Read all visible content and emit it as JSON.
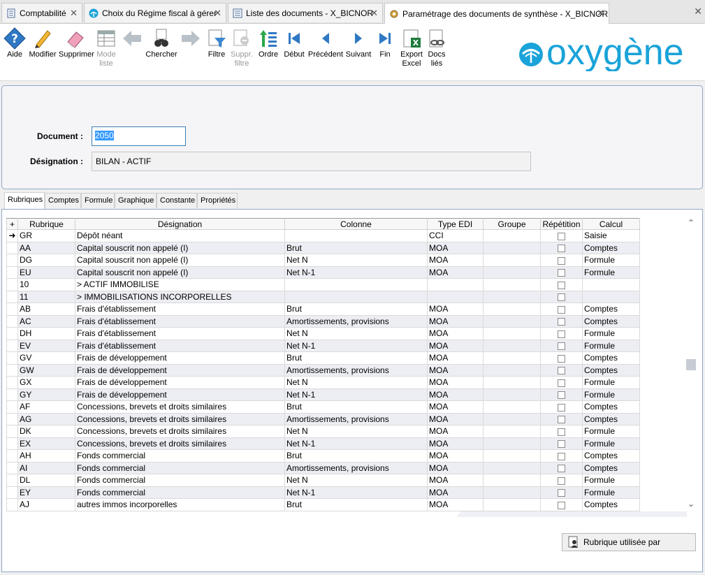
{
  "tabs": [
    {
      "label": "Comptabilité"
    },
    {
      "label": "Choix du Régime fiscal à gérer"
    },
    {
      "label": "Liste des documents - X_BICNOR"
    },
    {
      "label": "Paramétrage des documents de synthèse - X_BICNOR"
    }
  ],
  "toolbar": {
    "aide": "Aide",
    "modifier": "Modifier",
    "supprimer": "Supprimer",
    "mode_liste_1": "Mode",
    "mode_liste_2": "liste",
    "chercher": "Chercher",
    "filtre": "Filtre",
    "suppr_filtre_1": "Suppr.",
    "suppr_filtre_2": "filtre",
    "ordre": "Ordre",
    "debut": "Début",
    "precedent": "Précédent",
    "suivant": "Suivant",
    "fin": "Fin",
    "export_1": "Export",
    "export_2": "Excel",
    "docs_1": "Docs",
    "docs_2": "liés"
  },
  "brand": {
    "name": "oxygène",
    "color": "#1aa3d9"
  },
  "form": {
    "document_label": "Document :",
    "document_value": "2050",
    "designation_label": "Désignation :",
    "designation_value": "BILAN - ACTIF"
  },
  "section_tabs": [
    "Rubriques",
    "Comptes",
    "Formule",
    "Graphique",
    "Constante",
    "Propriétés"
  ],
  "grid": {
    "columns": [
      "Rubrique",
      "Désignation",
      "Colonne",
      "Type EDI",
      "Groupe",
      "Répétition",
      "Calcul"
    ],
    "rows": [
      {
        "rub": "GR",
        "des": "Dépôt néant",
        "col": "",
        "edi": "CCI",
        "grp": "",
        "calc": "Saisie"
      },
      {
        "rub": "AA",
        "des": "Capital souscrit non appelé (I)",
        "col": "Brut",
        "edi": "MOA",
        "grp": "",
        "calc": "Comptes"
      },
      {
        "rub": "DG",
        "des": "Capital souscrit non appelé (I)",
        "col": "Net N",
        "edi": "MOA",
        "grp": "",
        "calc": "Formule"
      },
      {
        "rub": "EU",
        "des": "Capital souscrit non appelé (I)",
        "col": "Net N-1",
        "edi": "MOA",
        "grp": "",
        "calc": "Formule"
      },
      {
        "rub": "10",
        "des": "> ACTIF IMMOBILISE",
        "col": "",
        "edi": "",
        "grp": "",
        "calc": ""
      },
      {
        "rub": "11",
        "des": "> IMMOBILISATIONS INCORPORELLES",
        "col": "",
        "edi": "",
        "grp": "",
        "calc": ""
      },
      {
        "rub": "AB",
        "des": "Frais d'établissement",
        "col": "Brut",
        "edi": "MOA",
        "grp": "",
        "calc": "Comptes"
      },
      {
        "rub": "AC",
        "des": "Frais d'établissement",
        "col": "Amortissements, provisions",
        "edi": "MOA",
        "grp": "",
        "calc": "Comptes"
      },
      {
        "rub": "DH",
        "des": "Frais d'établissement",
        "col": "Net N",
        "edi": "MOA",
        "grp": "",
        "calc": "Formule"
      },
      {
        "rub": "EV",
        "des": "Frais d'établissement",
        "col": "Net N-1",
        "edi": "MOA",
        "grp": "",
        "calc": "Formule"
      },
      {
        "rub": "GV",
        "des": "Frais de développement",
        "col": "Brut",
        "edi": "MOA",
        "grp": "",
        "calc": "Comptes"
      },
      {
        "rub": "GW",
        "des": "Frais de développement",
        "col": "Amortissements, provisions",
        "edi": "MOA",
        "grp": "",
        "calc": "Comptes"
      },
      {
        "rub": "GX",
        "des": "Frais de développement",
        "col": "Net N",
        "edi": "MOA",
        "grp": "",
        "calc": "Formule"
      },
      {
        "rub": "GY",
        "des": "Frais de développement",
        "col": "Net N-1",
        "edi": "MOA",
        "grp": "",
        "calc": "Formule"
      },
      {
        "rub": "AF",
        "des": "Concessions, brevets et droits similaires",
        "col": "Brut",
        "edi": "MOA",
        "grp": "",
        "calc": "Comptes"
      },
      {
        "rub": "AG",
        "des": "Concessions, brevets et droits similaires",
        "col": "Amortissements, provisions",
        "edi": "MOA",
        "grp": "",
        "calc": "Comptes"
      },
      {
        "rub": "DK",
        "des": "Concessions, brevets et droits similaires",
        "col": "Net N",
        "edi": "MOA",
        "grp": "",
        "calc": "Formule"
      },
      {
        "rub": "EX",
        "des": "Concessions, brevets et droits similaires",
        "col": "Net N-1",
        "edi": "MOA",
        "grp": "",
        "calc": "Formule"
      },
      {
        "rub": "AH",
        "des": "Fonds commercial",
        "col": "Brut",
        "edi": "MOA",
        "grp": "",
        "calc": "Comptes"
      },
      {
        "rub": "AI",
        "des": "Fonds commercial",
        "col": "Amortissements, provisions",
        "edi": "MOA",
        "grp": "",
        "calc": "Comptes"
      },
      {
        "rub": "DL",
        "des": "Fonds commercial",
        "col": "Net N",
        "edi": "MOA",
        "grp": "",
        "calc": "Formule"
      },
      {
        "rub": "EY",
        "des": "Fonds commercial",
        "col": "Net N-1",
        "edi": "MOA",
        "grp": "",
        "calc": "Formule"
      },
      {
        "rub": "AJ",
        "des": "autres immos incorporelles",
        "col": "Brut",
        "edi": "MOA",
        "grp": "",
        "calc": "Comptes"
      }
    ]
  },
  "buttons": {
    "used_by": "Rubrique utilisée par"
  }
}
